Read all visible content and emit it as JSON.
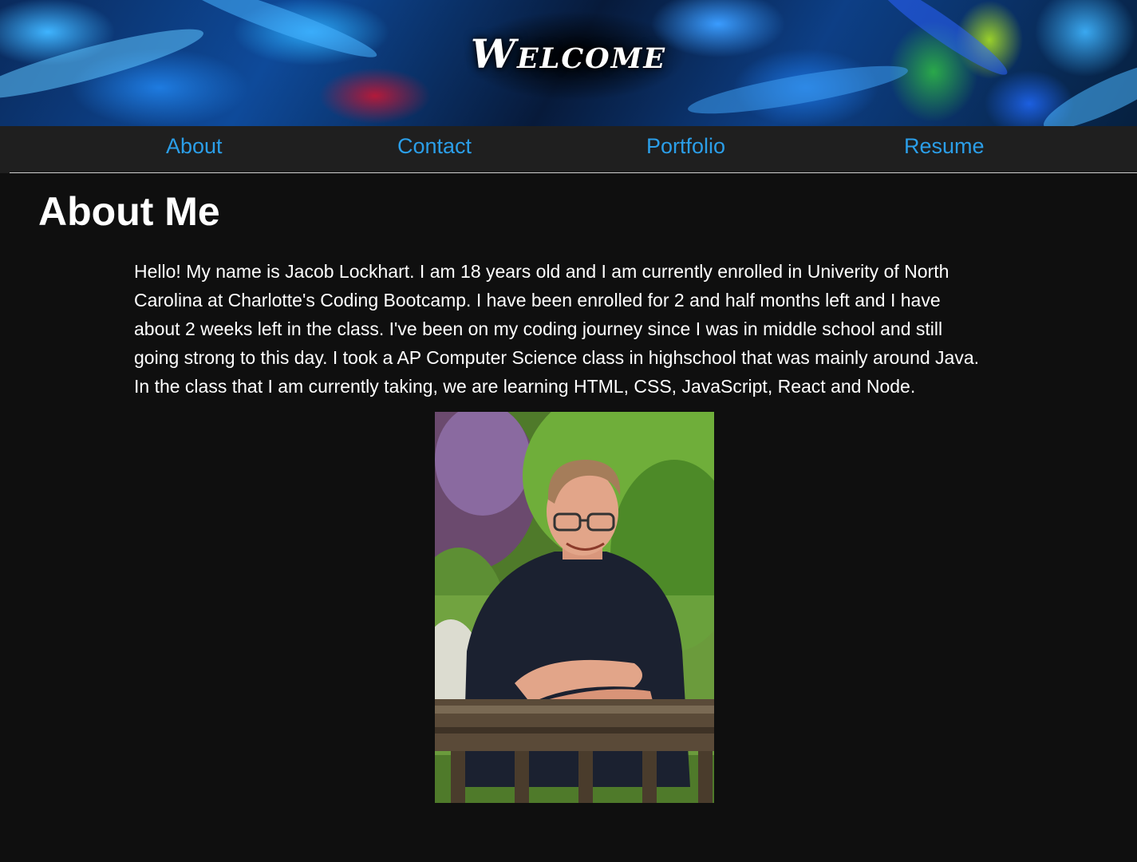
{
  "header": {
    "title": "Welcome"
  },
  "nav": {
    "items": [
      {
        "label": "About"
      },
      {
        "label": "Contact"
      },
      {
        "label": "Portfolio"
      },
      {
        "label": "Resume"
      }
    ],
    "link_color": "#2b9ee8"
  },
  "about": {
    "heading": "About Me",
    "lines": [
      "Hello! My name is Jacob Lockhart. I am 18 years old and I am currently enrolled in Univerity of North",
      "Carolina at Charlotte's Coding Bootcamp. I have been enrolled for 2 and half months left and I have",
      "about 2 weeks left in the class. I've been on my coding journey since I was in middle school and still",
      "going strong to this day. I took a AP Computer Science class in highschool that was mainly around Java.",
      "In the class that I am currently taking, we are learning HTML, CSS, JavaScript, React and Node."
    ]
  }
}
